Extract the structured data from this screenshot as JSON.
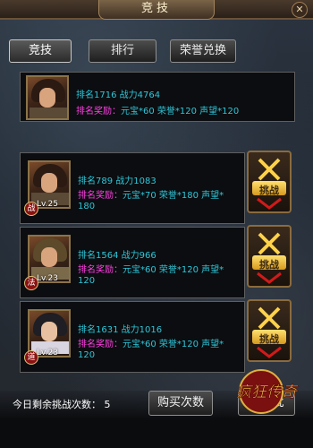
{
  "title": "竞技",
  "tabs": [
    {
      "label": "竞技"
    },
    {
      "label": "排行"
    },
    {
      "label": "荣誉兑换"
    }
  ],
  "self": {
    "rank_line": "排名1716 战力4764",
    "reward_label": "排名奖励：",
    "reward_value": "元宝*60 荣誉*120 声望*120"
  },
  "opponents": [
    {
      "level": "Lv.25",
      "class": "战",
      "rank_line": "排名789 战力1083",
      "reward_label": "排名奖励：",
      "reward_value": "元宝*70 荣誉*180 声望*",
      "reward_cont": "180",
      "challenge": "挑战"
    },
    {
      "level": "Lv.23",
      "class": "法",
      "rank_line": "排名1564 战力966",
      "reward_label": "排名奖励：",
      "reward_value": "元宝*60 荣誉*120 声望*",
      "reward_cont": "120",
      "challenge": "挑战"
    },
    {
      "level": "Lv.23",
      "class": "道",
      "rank_line": "排名1631 战力1016",
      "reward_label": "排名奖励：",
      "reward_value": "元宝*60 荣誉*120 声望*",
      "reward_cont": "120",
      "challenge": "挑战"
    }
  ],
  "bottom": {
    "remain_text": "今日剩余挑战次数： 5",
    "buy_button": "购买次数",
    "batch_button": "换一批"
  },
  "logo": {
    "text": "疯狂传奇"
  },
  "colors": {
    "accent_cyan": "#2fc6d8",
    "reward_magenta": "#ff3fe2",
    "gold": "#d69a1e"
  }
}
